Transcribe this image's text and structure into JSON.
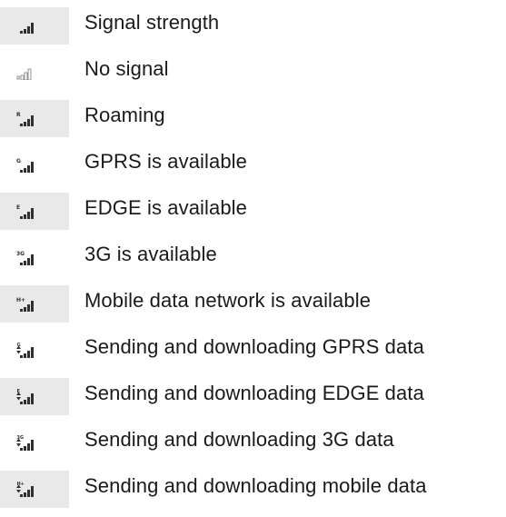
{
  "rows": [
    {
      "label": "Signal strength",
      "icon": "signal-strength-icon",
      "variant": "bars",
      "tag": ""
    },
    {
      "label": "No signal",
      "icon": "no-signal-icon",
      "variant": "outline",
      "tag": ""
    },
    {
      "label": "Roaming",
      "icon": "roaming-icon",
      "variant": "bars",
      "tag": "R"
    },
    {
      "label": "GPRS is available",
      "icon": "gprs-icon",
      "variant": "bars",
      "tag": "G"
    },
    {
      "label": "EDGE is available",
      "icon": "edge-icon",
      "variant": "bars",
      "tag": "E"
    },
    {
      "label": "3G is available",
      "icon": "3g-icon",
      "variant": "bars",
      "tag": "3G"
    },
    {
      "label": "Mobile data network is available",
      "icon": "hplus-icon",
      "variant": "bars",
      "tag": "H+"
    },
    {
      "label": "Sending and downloading GPRS data",
      "icon": "gprs-transfer-icon",
      "variant": "arrows",
      "tag": "G"
    },
    {
      "label": "Sending and downloading EDGE data",
      "icon": "edge-transfer-icon",
      "variant": "arrows",
      "tag": "E"
    },
    {
      "label": "Sending and downloading 3G data",
      "icon": "3g-transfer-icon",
      "variant": "arrows",
      "tag": "3G"
    },
    {
      "label": "Sending and downloading mobile data",
      "icon": "hplus-transfer-icon",
      "variant": "arrows",
      "tag": "H+"
    }
  ]
}
